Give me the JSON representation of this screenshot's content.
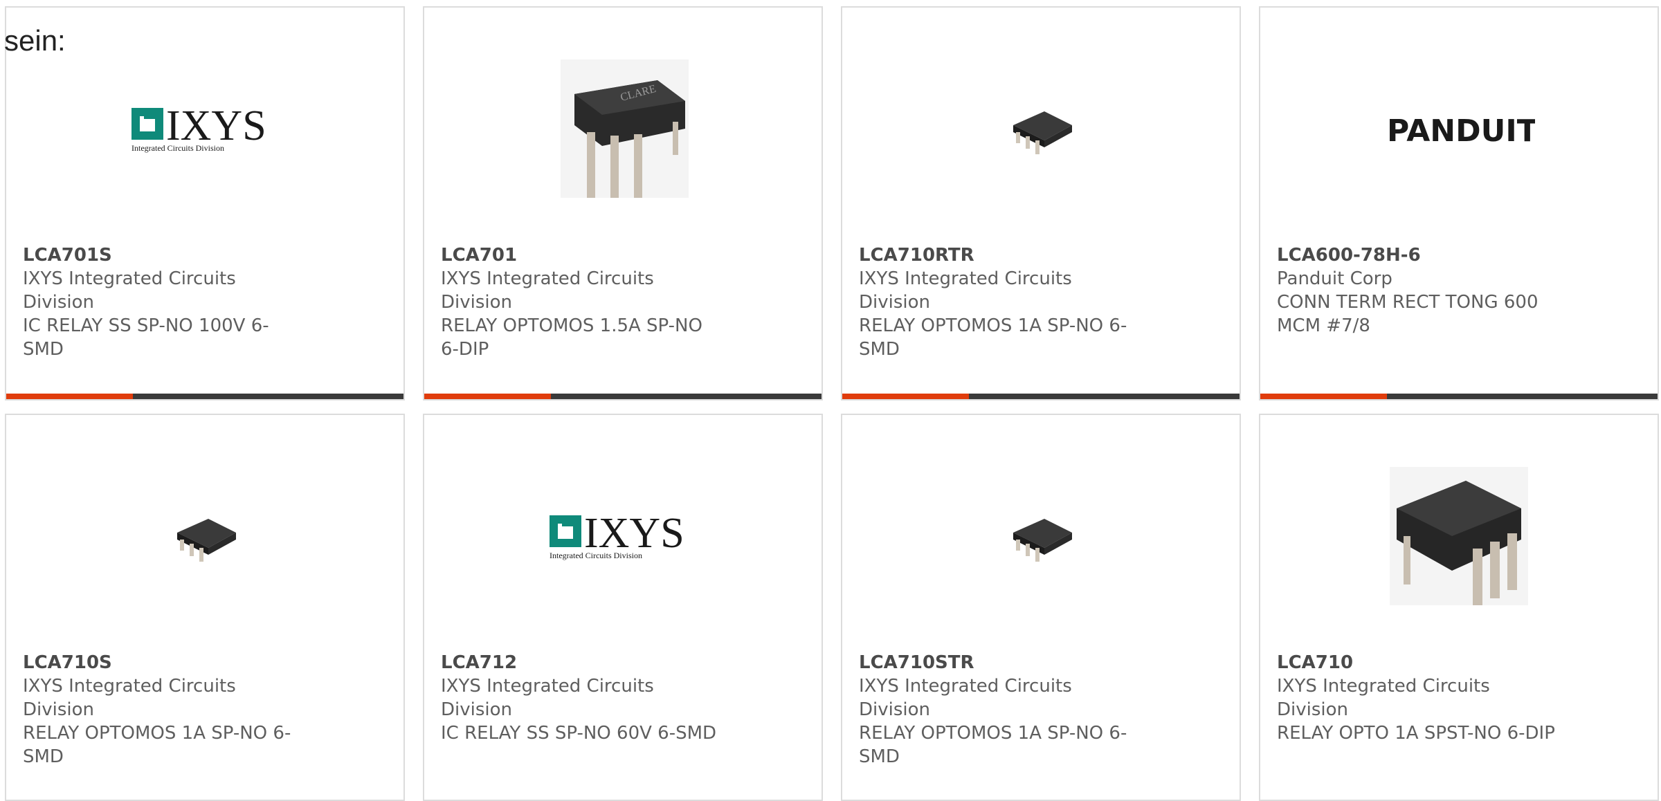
{
  "intro_text": "sein:",
  "colors": {
    "accent": "#e03c0c",
    "bar": "#3a3a3a",
    "border": "#dcdcdc",
    "ixys_teal": "#0f8a7a",
    "text": "#5e5e5e"
  },
  "logos": {
    "ixys_word": "IXYS",
    "ixys_sub": "Integrated Circuits Division",
    "panduit_word": "PANDUIT",
    "clare_mark": "CLARE"
  },
  "products": [
    {
      "part": "LCA701S",
      "maker": "IXYS Integrated Circuits Division",
      "desc": "IC RELAY SS SP-NO 100V 6-SMD",
      "image": "ixys-logo"
    },
    {
      "part": "LCA701",
      "maker": "IXYS Integrated Circuits Division",
      "desc": "RELAY OPTOMOS 1.5A SP-NO 6-DIP",
      "image": "dip6-clare-chip"
    },
    {
      "part": "LCA710RTR",
      "maker": "IXYS Integrated Circuits Division",
      "desc": "RELAY OPTOMOS 1A SP-NO 6-SMD",
      "image": "smd6-chip"
    },
    {
      "part": "LCA600-78H-6",
      "maker": "Panduit Corp",
      "desc": "CONN TERM RECT TONG 600 MCM #7/8",
      "image": "panduit-logo"
    },
    {
      "part": "LCA710S",
      "maker": "IXYS Integrated Circuits Division",
      "desc": "RELAY OPTOMOS 1A SP-NO 6-SMD",
      "image": "smd6-chip"
    },
    {
      "part": "LCA712",
      "maker": "IXYS Integrated Circuits Division",
      "desc": "IC RELAY SS SP-NO 60V 6-SMD",
      "image": "ixys-logo"
    },
    {
      "part": "LCA710STR",
      "maker": "IXYS Integrated Circuits Division",
      "desc": "RELAY OPTOMOS 1A SP-NO 6-SMD",
      "image": "smd6-chip"
    },
    {
      "part": "LCA710",
      "maker": "IXYS Integrated Circuits Division",
      "desc": "RELAY OPTO 1A SPST-NO 6-DIP",
      "image": "dip6-chip"
    }
  ]
}
